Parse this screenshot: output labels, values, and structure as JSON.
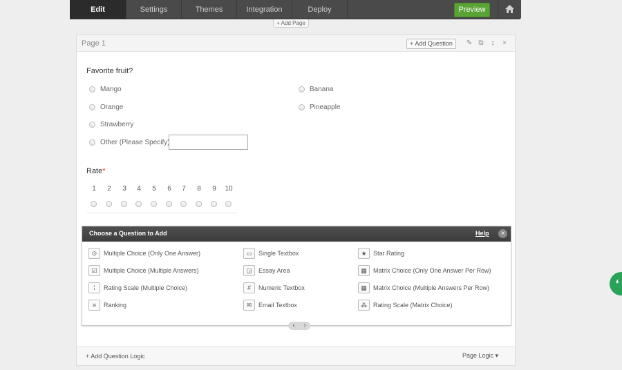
{
  "nav": {
    "tabs": [
      "Edit",
      "Settings",
      "Themes",
      "Integration",
      "Deploy"
    ],
    "preview_label": "Preview"
  },
  "add_page_label": "+ Add Page",
  "page": {
    "title": "Page 1",
    "add_question_label": "+ Add Question",
    "header_icons": [
      "edit-icon",
      "copy-icon",
      "move-icon",
      "close-icon"
    ]
  },
  "question1": {
    "title": "Favorite fruit?",
    "options": [
      "Mango",
      "Banana",
      "Orange",
      "Pineapple",
      "Strawberry",
      "Other (Please Specify)"
    ],
    "other_value": ""
  },
  "question2": {
    "title": "Rate",
    "required_mark": "*",
    "scale": [
      "1",
      "2",
      "3",
      "4",
      "5",
      "6",
      "7",
      "8",
      "9",
      "10"
    ]
  },
  "chooser": {
    "title": "Choose a Question to Add",
    "help_label": "Help",
    "close_glyph": "×",
    "types": [
      "Multiple Choice (Only One Answer)",
      "Single Textbox",
      "Star Rating",
      "Multiple Choice (Multiple Answers)",
      "Essay Area",
      "Matrix Choice (Only One Answer Per Row)",
      "Rating Scale (Multiple Choice)",
      "Numeric Textbox",
      "Matrix Choice (Multiple Answers Per Row)",
      "Ranking",
      "Email Textbox",
      "Rating Scale (Matrix Choice)"
    ],
    "pager_prev": "‹",
    "pager_next": "›"
  },
  "footer": {
    "add_logic_label": "+ Add Question Logic",
    "page_logic_label": "Page Logic ▾"
  },
  "float_button_glyph": "❛",
  "colors": {
    "nav_bg": "#4a4a4a",
    "preview_green": "#5aa335",
    "chooser_header": "#444444",
    "feedback_green": "#29a35a"
  }
}
